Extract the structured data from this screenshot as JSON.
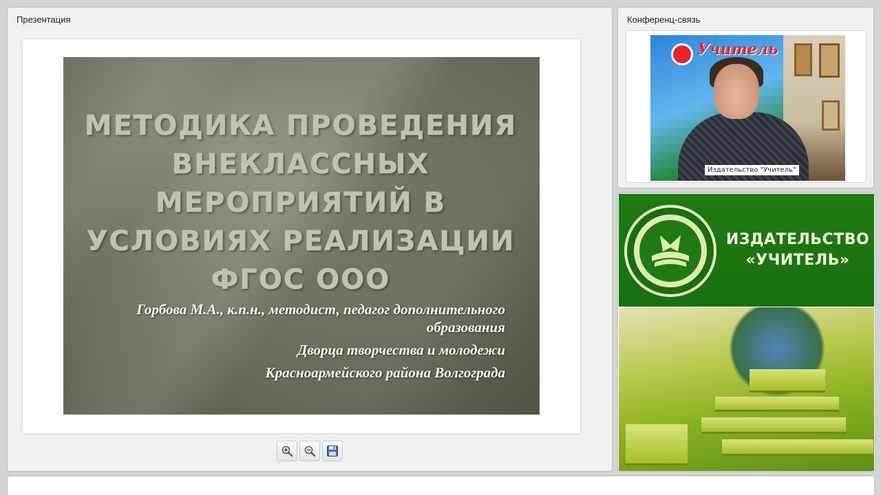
{
  "presentation": {
    "title": "Презентация",
    "slide": {
      "title": "МЕТОДИКА ПРОВЕДЕНИЯ ВНЕКЛАССНЫХ МЕРОПРИЯТИЙ В УСЛОВИЯХ РЕАЛИЗАЦИИ ФГОС ООО",
      "author_lines": [
        "Горбова М.А., к.п.н., методист,  педагог дополнительного образования",
        "Дворца творчества и молодежи",
        "Красноармейского района Волгограда"
      ]
    },
    "toolbar": {
      "zoom_in_icon": "zoom-in-icon",
      "zoom_out_icon": "zoom-out-icon",
      "save_icon": "floppy-disk-icon"
    }
  },
  "conference": {
    "title": "Конференц-связь",
    "video_label": "Издательство \"Учитель\"",
    "poster_text": "Учитель"
  },
  "banner": {
    "line1": "ИЗДАТЕЛЬСТВО",
    "line2": "«УЧИТЕЛЬ»",
    "color": "#1f7a12"
  }
}
